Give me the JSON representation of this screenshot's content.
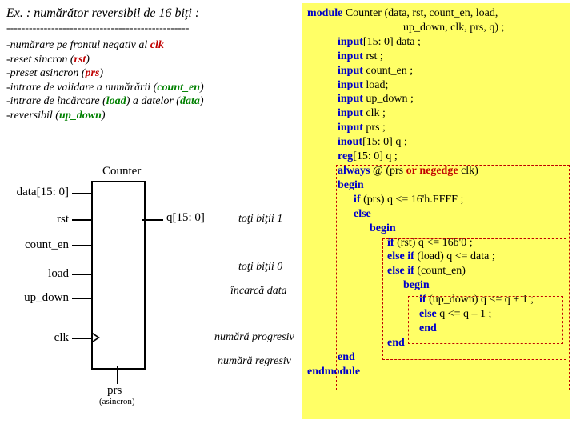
{
  "title": "Ex. : numărător reversibil de 16 biţi :",
  "dashes": "-------------------------------------------------",
  "specs": {
    "l1a": "-numărare pe frontul negativ al ",
    "l1b": "clk",
    "l2a": "-reset sincron (",
    "l2b": "rst",
    "l2c": ")",
    "l3a": "-preset asincron (",
    "l3b": "prs",
    "l3c": ")",
    "l4a": "-intrare de validare a numărării (",
    "l4b": "count_en",
    "l4c": ")",
    "l5a": "-intrare de încărcare (",
    "l5b": "load",
    "l5c": ") a datelor (",
    "l5d": "data",
    "l5e": ")",
    "l6a": "-reversibil (",
    "l6b": "up_down",
    "l6c": ")"
  },
  "diagram": {
    "counter": "Counter",
    "data": "data[15: 0]",
    "rst": "rst",
    "count_en": "count_en",
    "load": "load",
    "up_down": "up_down",
    "clk": "clk",
    "prs": "prs",
    "asincron": "(asincron)",
    "q": "q[15: 0]"
  },
  "annot": {
    "a1": "toţi biţii 1",
    "a2": "toţi biţii 0",
    "a3": "încarcă data",
    "a4": "numără progresiv",
    "a5": "numără regresiv"
  },
  "code": {
    "k_module": "module",
    "k_input": "input",
    "k_inout": "inout",
    "k_reg": "reg",
    "k_always": "always",
    "k_begin": "begin",
    "k_end": "end",
    "k_endmodule": "endmodule",
    "k_if": "if",
    "k_else": "else",
    "k_elseif": "else if",
    "k_or": "or",
    "k_negedge": "negedge",
    "hdr1": " Counter (data, rst, count_en, load,",
    "hdr2": "up_down, clk, prs, q) ;",
    "p_data": "[15: 0]   data ;",
    "p_rst": "              rst ;",
    "p_ce": "              count_en ;",
    "p_load": "              load;",
    "p_ud": "              up_down ;",
    "p_clk": "              clk ;",
    "p_prs": "              prs ;",
    "p_q": "[15: 0]     q ;",
    "p_rq": "[15: 0]       q ;",
    "alw1": " @ (prs ",
    "alw2": " clk)",
    "if_prs": " (prs)  q <= 16'h.FFFF ;",
    "if_rst": " (rst)  q <= 16b'0 ;",
    "if_load": " (load)  q <= data ;",
    "if_ce": " (count_en)",
    "if_ud": " (up_down)  q <= q + 1 ;",
    "else_dec": " q <= q – 1 ;"
  }
}
